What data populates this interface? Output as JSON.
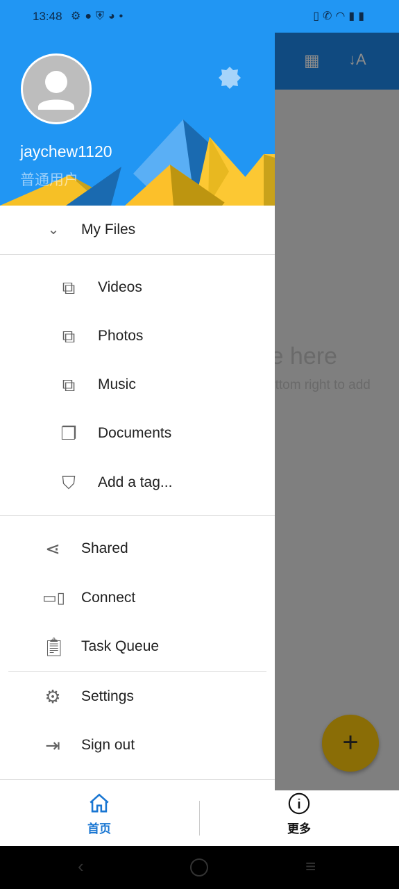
{
  "status_bar": {
    "time": "13:48",
    "left_icons": [
      "settings-icon",
      "location-icon",
      "shield-icon",
      "speed-icon",
      "dot"
    ],
    "right_icons": [
      "vibrate-icon",
      "wifi-call-icon",
      "wifi-icon",
      "signal-icon",
      "battery-icon"
    ]
  },
  "background": {
    "empty_title": "le here",
    "empty_hint": "ottom right to add",
    "fab_label": "+"
  },
  "header": {
    "username": "jaychew1120",
    "role": "普通用户",
    "theme_icon": "theme-toggle-icon"
  },
  "menu": {
    "my_files": "My Files",
    "sub": [
      {
        "label": "Videos",
        "icon": "video-library-icon"
      },
      {
        "label": "Photos",
        "icon": "photo-library-icon"
      },
      {
        "label": "Music",
        "icon": "music-library-icon"
      },
      {
        "label": "Documents",
        "icon": "documents-icon"
      },
      {
        "label": "Add a tag...",
        "icon": "add-tag-icon"
      }
    ],
    "main": [
      {
        "label": "Shared",
        "icon": "share-icon"
      },
      {
        "label": "Connect",
        "icon": "devices-icon"
      },
      {
        "label": "Task Queue",
        "icon": "clipboard-icon"
      }
    ],
    "bottom": [
      {
        "label": "Settings",
        "icon": "gear-icon"
      },
      {
        "label": "Sign out",
        "icon": "sign-out-icon"
      }
    ]
  },
  "tabs": [
    {
      "label": "首页",
      "active": true
    },
    {
      "label": "更多",
      "active": false
    }
  ],
  "colors": {
    "primary": "#2196f3",
    "accent": "#1976d2",
    "fab": "#8a6d06"
  }
}
